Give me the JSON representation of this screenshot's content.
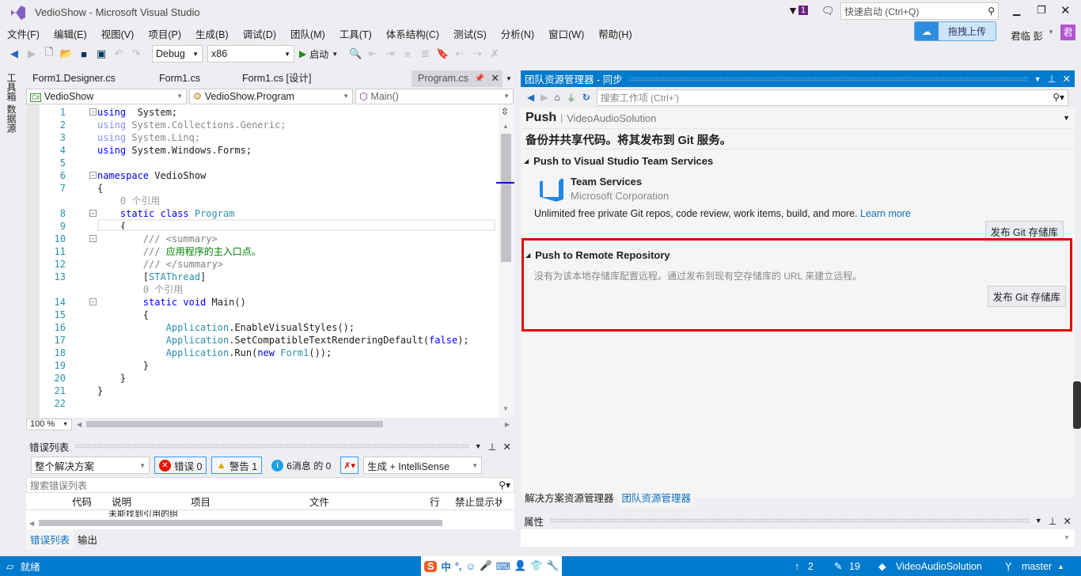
{
  "window": {
    "title": "VedioShow - Microsoft Visual Studio",
    "notification_count": "1",
    "quick_launch_placeholder": "快速启动 (Ctrl+Q)",
    "upload_label": "拖拽上传",
    "user": "君临 彭",
    "avatar_letter": "君"
  },
  "menu": [
    "文件(F)",
    "编辑(E)",
    "视图(V)",
    "项目(P)",
    "生成(B)",
    "调试(D)",
    "团队(M)",
    "工具(T)",
    "体系结构(C)",
    "测试(S)",
    "分析(N)",
    "窗口(W)",
    "帮助(H)"
  ],
  "toolbar": {
    "config": "Debug",
    "platform": "x86",
    "start_label": "启动"
  },
  "left_tabs": [
    "工具箱",
    "数据源"
  ],
  "editor": {
    "tabs": [
      "Form1.Designer.cs",
      "Form1.cs",
      "Form1.cs [设计]",
      "Program.cs"
    ],
    "active_tab": "Program.cs",
    "nav": {
      "project": "VedioShow",
      "class": "VedioShow.Program",
      "member": "Main()"
    },
    "zoom": "100 %",
    "lines": [
      {
        "n": "1",
        "tokens": [
          [
            "kw",
            "using"
          ],
          [
            "",
            "  System;"
          ]
        ]
      },
      {
        "n": "2",
        "tokens": [
          [
            "kwd",
            "using"
          ],
          [
            "txd",
            " System.Collections.Generic;"
          ]
        ]
      },
      {
        "n": "3",
        "tokens": [
          [
            "kwd",
            "using"
          ],
          [
            "txd",
            " System.Linq;"
          ]
        ]
      },
      {
        "n": "4",
        "tokens": [
          [
            "kw",
            "using"
          ],
          [
            "",
            " System.Windows.Forms;"
          ]
        ]
      },
      {
        "n": "5",
        "tokens": []
      },
      {
        "n": "6",
        "tokens": [
          [
            "kw",
            "namespace"
          ],
          [
            "",
            " VedioShow"
          ]
        ]
      },
      {
        "n": "7",
        "tokens": [
          [
            "",
            "{"
          ]
        ]
      },
      {
        "n": "",
        "tokens": [
          [
            "lens",
            "    0 个引用"
          ]
        ]
      },
      {
        "n": "8",
        "tokens": [
          [
            "",
            "    "
          ],
          [
            "kw",
            "static class"
          ],
          [
            "",
            " "
          ],
          [
            "ty",
            "Program"
          ]
        ]
      },
      {
        "n": "9",
        "tokens": [
          [
            "",
            "    {"
          ]
        ]
      },
      {
        "n": "10",
        "tokens": [
          [
            "cg",
            "        /// <summary>"
          ]
        ]
      },
      {
        "n": "11",
        "tokens": [
          [
            "cg",
            "        /// "
          ],
          [
            "cm",
            "应用程序的主入口点。"
          ]
        ]
      },
      {
        "n": "12",
        "tokens": [
          [
            "cg",
            "        /// </summary>"
          ]
        ]
      },
      {
        "n": "13",
        "tokens": [
          [
            "",
            "        ["
          ],
          [
            "ty",
            "STAThread"
          ],
          [
            "",
            "]"
          ]
        ]
      },
      {
        "n": "",
        "tokens": [
          [
            "lens",
            "        0 个引用"
          ]
        ]
      },
      {
        "n": "14",
        "tokens": [
          [
            "",
            "        "
          ],
          [
            "kw",
            "static void"
          ],
          [
            "",
            " Main()"
          ]
        ]
      },
      {
        "n": "15",
        "tokens": [
          [
            "",
            "        {"
          ]
        ]
      },
      {
        "n": "16",
        "tokens": [
          [
            "",
            "            "
          ],
          [
            "ty",
            "Application"
          ],
          [
            "",
            ".EnableVisualStyles();"
          ]
        ]
      },
      {
        "n": "17",
        "tokens": [
          [
            "",
            "            "
          ],
          [
            "ty",
            "Application"
          ],
          [
            "",
            ".SetCompatibleTextRenderingDefault("
          ],
          [
            "kw",
            "false"
          ],
          [
            "",
            ");"
          ]
        ]
      },
      {
        "n": "18",
        "tokens": [
          [
            "",
            "            "
          ],
          [
            "ty",
            "Application"
          ],
          [
            "",
            ".Run("
          ],
          [
            "kw",
            "new"
          ],
          [
            "",
            " "
          ],
          [
            "ty",
            "Form1"
          ],
          [
            "",
            "());"
          ]
        ]
      },
      {
        "n": "19",
        "tokens": [
          [
            "",
            "        }"
          ]
        ]
      },
      {
        "n": "20",
        "tokens": [
          [
            "",
            "    }"
          ]
        ]
      },
      {
        "n": "21",
        "tokens": [
          [
            "",
            "}"
          ]
        ]
      },
      {
        "n": "22",
        "tokens": []
      }
    ]
  },
  "error_list": {
    "title": "错误列表",
    "scope": "整个解决方案",
    "errors": "错误 0",
    "warnings": "警告 1",
    "messages": "6消息 的 0",
    "source": "生成 + IntelliSense",
    "search_placeholder": "搜索错误列表",
    "columns": [
      "代码",
      "说明",
      "项目",
      "文件",
      "行",
      "禁止显示状"
    ],
    "partial_row": "未能找到引用的组",
    "tabs": [
      "错误列表",
      "输出"
    ]
  },
  "team_explorer": {
    "title": "团队资源管理器 - 同步",
    "search_placeholder": "搜索工作项 (Ctrl+')",
    "page": "Push",
    "solution": "VideoAudioSolution",
    "heading": "备份并共享代码。将其发布到 Git 服务。",
    "vsts": {
      "title": "Push to Visual Studio Team Services",
      "service": "Team Services",
      "vendor": "Microsoft Corporation",
      "description": "Unlimited free private Git repos, code review, work items, build, and more.",
      "learn_more": "Learn more",
      "button": "发布 Git 存储库"
    },
    "remote": {
      "title": "Push to Remote Repository",
      "description": "没有为该本地存储库配置远程。通过发布到现有空存储库的 URL 来建立远程。",
      "button": "发布 Git 存储库"
    },
    "highlight_color": "#e00000",
    "tabs": [
      "解决方案资源管理器",
      "团队资源管理器"
    ],
    "active_tab": "团队资源管理器"
  },
  "properties": {
    "title": "属性"
  },
  "status": {
    "ready": "就绪",
    "ime": "中",
    "push_count": "2",
    "changes": "19",
    "repo": "VideoAudioSolution",
    "branch": "master"
  }
}
